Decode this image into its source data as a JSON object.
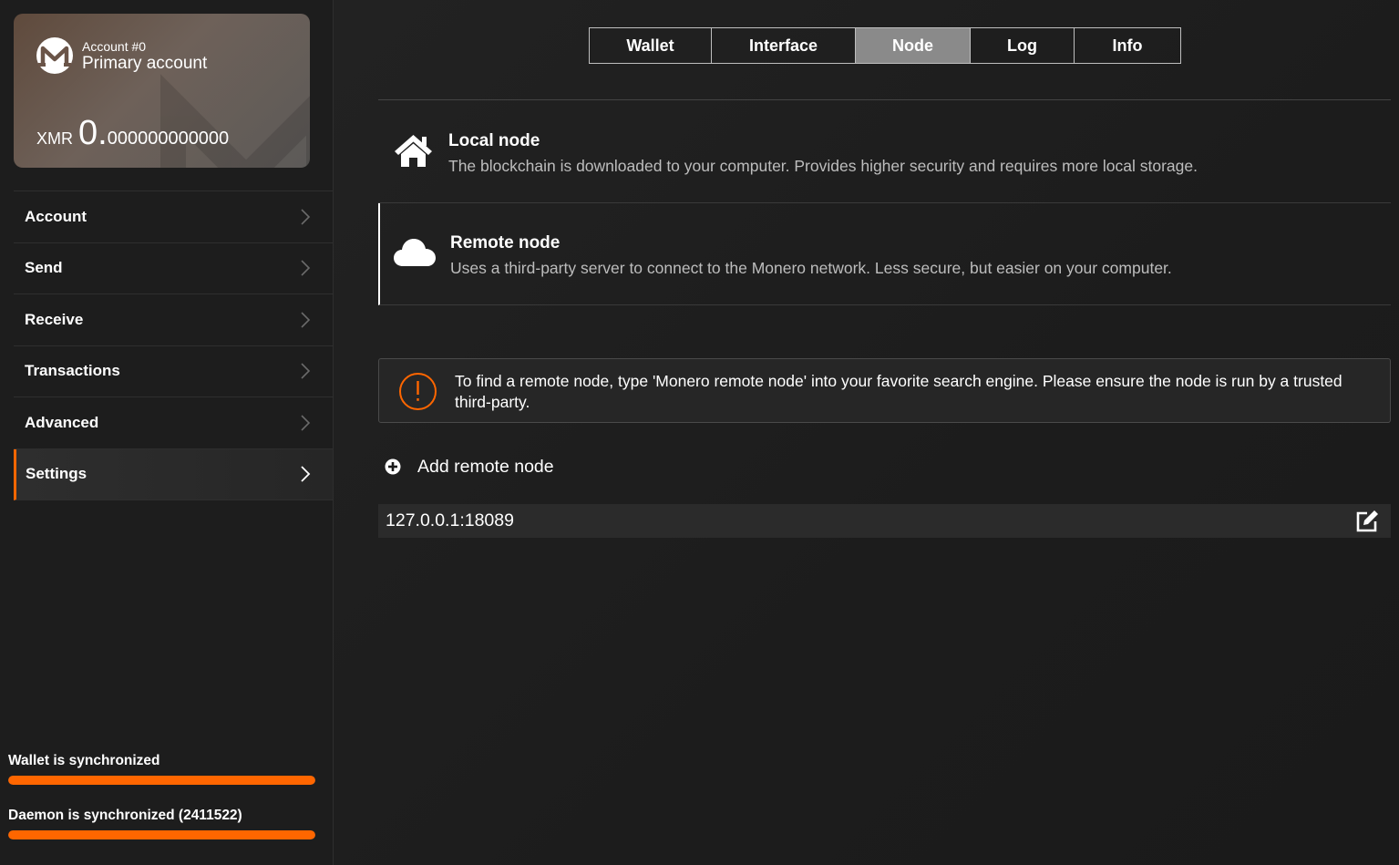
{
  "account_card": {
    "account_number": "Account #0",
    "account_name": "Primary account",
    "currency": "XMR",
    "balance_integer": "0.",
    "balance_decimal": "000000000000"
  },
  "nav": {
    "items": [
      {
        "label": "Account"
      },
      {
        "label": "Send"
      },
      {
        "label": "Receive"
      },
      {
        "label": "Transactions"
      },
      {
        "label": "Advanced"
      },
      {
        "label": "Settings",
        "active": true
      }
    ]
  },
  "sync": {
    "wallet_label": "Wallet is synchronized",
    "wallet_progress": 1.0,
    "daemon_label": "Daemon is synchronized (2411522)",
    "daemon_progress": 1.0
  },
  "tabs": [
    {
      "label": "Wallet"
    },
    {
      "label": "Interface"
    },
    {
      "label": "Node",
      "active": true
    },
    {
      "label": "Log"
    },
    {
      "label": "Info"
    }
  ],
  "node": {
    "local": {
      "title": "Local node",
      "description": "The blockchain is downloaded to your computer. Provides higher security and requires more local storage.",
      "icon": "house-icon"
    },
    "remote": {
      "title": "Remote node",
      "description": "Uses a third-party server to connect to the Monero network. Less secure, but easier on your computer.",
      "icon": "cloud-icon",
      "selected": true
    },
    "warning": "To find a remote node, type 'Monero remote node' into your favorite search engine. Please ensure the node is run by a trusted third-party.",
    "add_label": "Add remote node",
    "remote_address": "127.0.0.1:18089"
  },
  "colors": {
    "accent": "#ff6600",
    "background": "#1b1b1b",
    "active_tab": "#8a8a8a"
  }
}
